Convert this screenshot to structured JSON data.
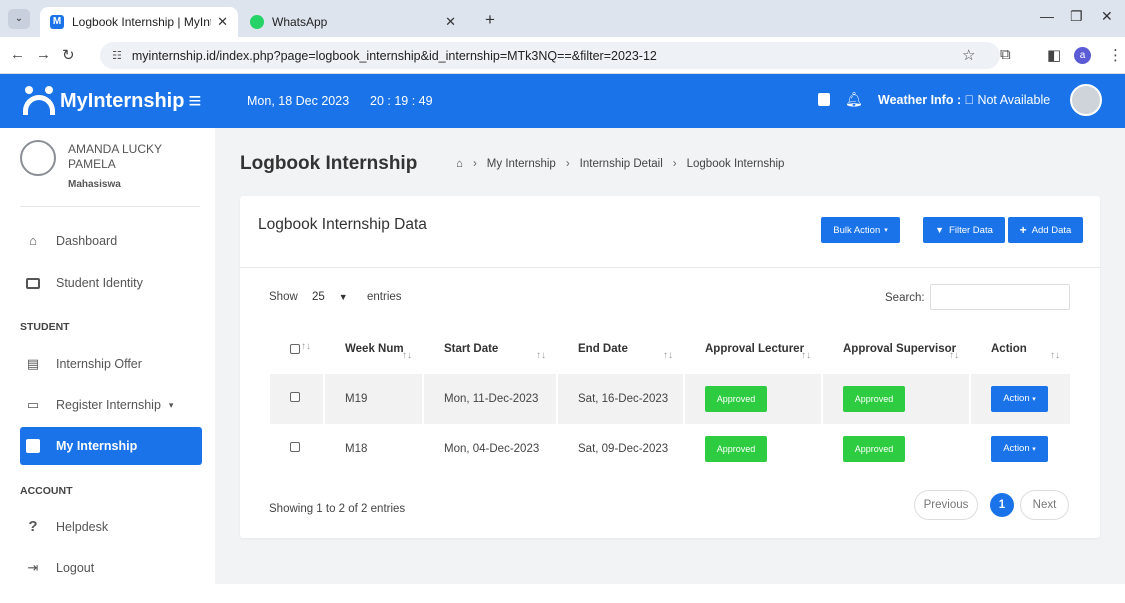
{
  "browser": {
    "tabs": [
      {
        "title": "Logbook Internship | MyInterns",
        "favicon": "myinternship-icon"
      },
      {
        "title": "WhatsApp",
        "favicon": "whatsapp-icon"
      }
    ],
    "url": "myinternship.id/index.php?page=logbook_internship&id_internship=MTk3NQ==&filter=2023-12",
    "profile_letter": "a"
  },
  "app": {
    "brand": "MyInternship",
    "date": "Mon, 18 Dec 2023",
    "time": "20 : 19 : 49",
    "weather_label": "Weather Info :",
    "weather_value": "Not Available"
  },
  "sidebar": {
    "user_name": "AMANDA LUCKY PAMELA",
    "user_role": "Mahasiswa",
    "items": [
      {
        "label": "Dashboard",
        "icon": "home-icon"
      },
      {
        "label": "Student Identity",
        "icon": "id-card-icon"
      },
      {
        "label": "Internship Offer",
        "icon": "building-icon"
      },
      {
        "label": "Register Internship",
        "icon": "form-icon"
      },
      {
        "label": "My Internship",
        "icon": "briefcase-icon"
      },
      {
        "label": "Helpdesk",
        "icon": "question-icon"
      },
      {
        "label": "Logout",
        "icon": "logout-icon"
      }
    ],
    "sections": {
      "student": "STUDENT",
      "account": "ACCOUNT"
    }
  },
  "page": {
    "title": "Logbook Internship",
    "breadcrumb": [
      "My Internship",
      "Internship Detail",
      "Logbook Internship"
    ]
  },
  "card": {
    "title": "Logbook Internship Data",
    "bulk_action": "Bulk Action",
    "filter_data": "Filter Data",
    "add_data": "Add Data",
    "show_label": "Show",
    "show_value": "25",
    "entries_label": "entries",
    "search_label": "Search:",
    "columns": [
      "Week Num",
      "Start Date",
      "End Date",
      "Approval Lecturer",
      "Approval Supervisor",
      "Action"
    ],
    "rows": [
      {
        "week": "M19",
        "start": "Mon, 11-Dec-2023",
        "end": "Sat, 16-Dec-2023",
        "lecturer": "Approved",
        "supervisor": "Approved",
        "action": "Action"
      },
      {
        "week": "M18",
        "start": "Mon, 04-Dec-2023",
        "end": "Sat, 09-Dec-2023",
        "lecturer": "Approved",
        "supervisor": "Approved",
        "action": "Action"
      }
    ],
    "info": "Showing 1 to 2 of 2 entries",
    "pagination": {
      "previous": "Previous",
      "current": "1",
      "next": "Next"
    }
  },
  "colors": {
    "primary": "#1a73e8",
    "approved": "#2ecc40"
  }
}
